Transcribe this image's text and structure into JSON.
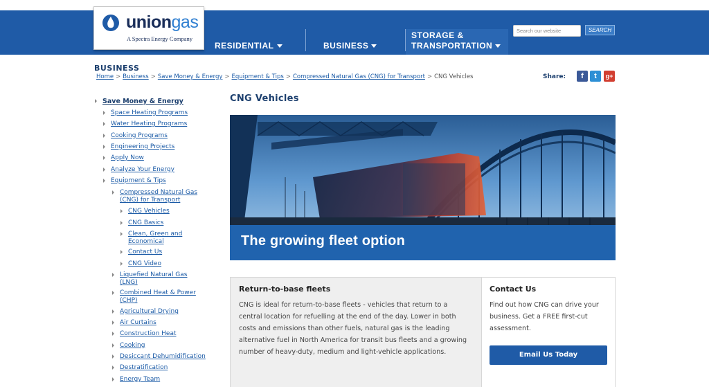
{
  "brand": {
    "name_part1": "union",
    "name_part2": "gas",
    "tagline": "A Spectra Energy Company",
    "primary_color": "#1f5ba7",
    "dark_color": "#1c3f6e"
  },
  "nav": {
    "residential": "RESIDENTIAL",
    "business": "BUSINESS",
    "storage_line1": "STORAGE &",
    "storage_line2": "TRANSPORTATION"
  },
  "search": {
    "placeholder": "Search our website",
    "button": "SEARCH"
  },
  "section_title": "BUSINESS",
  "breadcrumb": {
    "items": [
      "Home",
      "Business",
      "Save Money & Energy",
      "Equipment & Tips",
      "Compressed Natural Gas (CNG) for Transport"
    ],
    "current": "CNG Vehicles",
    "separator": ">"
  },
  "share": {
    "label": "Share:",
    "icons": [
      "facebook-icon",
      "twitter-icon",
      "google-plus-icon"
    ],
    "facebook_glyph": "f",
    "twitter_glyph": "t",
    "gplus_glyph": "g+"
  },
  "leftnav": {
    "save_money": "Save Money & Energy",
    "space_heating": "Space Heating Programs",
    "water_heating": "Water Heating Programs",
    "cooking_programs": "Cooking Programs",
    "engineering": "Engineering Projects",
    "apply_now": "Apply Now",
    "analyze": "Analyze Your Energy",
    "equipment": "Equipment & Tips",
    "cng_line1": "Compressed Natural Gas",
    "cng_line2": "(CNG) for Transport",
    "cng_vehicles": "CNG Vehicles",
    "cng_basics": "CNG Basics",
    "clean_line1": "Clean, Green and",
    "clean_line2": "Economical",
    "contact_us": "Contact Us",
    "cng_video": "CNG Video",
    "lng_line1": "Liquefied Natural Gas",
    "lng_line2": "(LNG)",
    "chp_line1": "Combined Heat & Power",
    "chp_line2": "(CHP)",
    "agricultural": "Agricultural Drying",
    "air_curtains": "Air Curtains",
    "construction": "Construction Heat",
    "cooking": "Cooking",
    "desiccant": "Desiccant Dehumidification",
    "destratification": "Destratification",
    "energy_team": "Energy Team"
  },
  "main": {
    "title": "CNG Vehicles",
    "hero_caption": "The growing fleet option",
    "info": {
      "heading": "Return-to-base fleets",
      "body": "CNG is ideal for return-to-base fleets - vehicles that return to a central location for refuelling at the end of the day. Lower in both costs and emissions than other fuels, natural gas is the leading alternative fuel in North America for transit bus fleets and a growing number of heavy-duty, medium and light-vehicle applications."
    },
    "contact": {
      "heading": "Contact Us",
      "body": "Find out how CNG can drive your business. Get a FREE first-cut assessment.",
      "button": "Email Us Today"
    }
  }
}
